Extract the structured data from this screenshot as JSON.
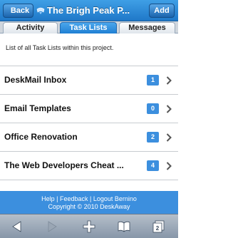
{
  "navbar": {
    "back_label": "Back",
    "title": "The Brigh Peak P...",
    "add_label": "Add"
  },
  "tabs": [
    {
      "label": "Activity",
      "active": false
    },
    {
      "label": "Task Lists",
      "active": true
    },
    {
      "label": "Messages",
      "active": false
    }
  ],
  "description": "List of all Task Lists within this project.",
  "task_lists": [
    {
      "name": "DeskMail Inbox",
      "count": "1"
    },
    {
      "name": "Email Templates",
      "count": "0"
    },
    {
      "name": "Office Renovation",
      "count": "2"
    },
    {
      "name": "The Web Developers Cheat ...",
      "count": "4"
    }
  ],
  "footer": {
    "help": "Help",
    "feedback": "Feedback",
    "logout": "Logout Bernino",
    "separator": " | ",
    "copyright": "Copyright © 2010 DeskAway"
  },
  "toolbar": {
    "tab_count": "2",
    "icons": [
      "back-arrow-icon",
      "forward-arrow-icon",
      "plus-icon",
      "bookmarks-icon",
      "pages-icon"
    ]
  },
  "colors": {
    "navbar": "#1f78c8",
    "accent": "#3c8fde",
    "toolbar": "#8796a8"
  }
}
